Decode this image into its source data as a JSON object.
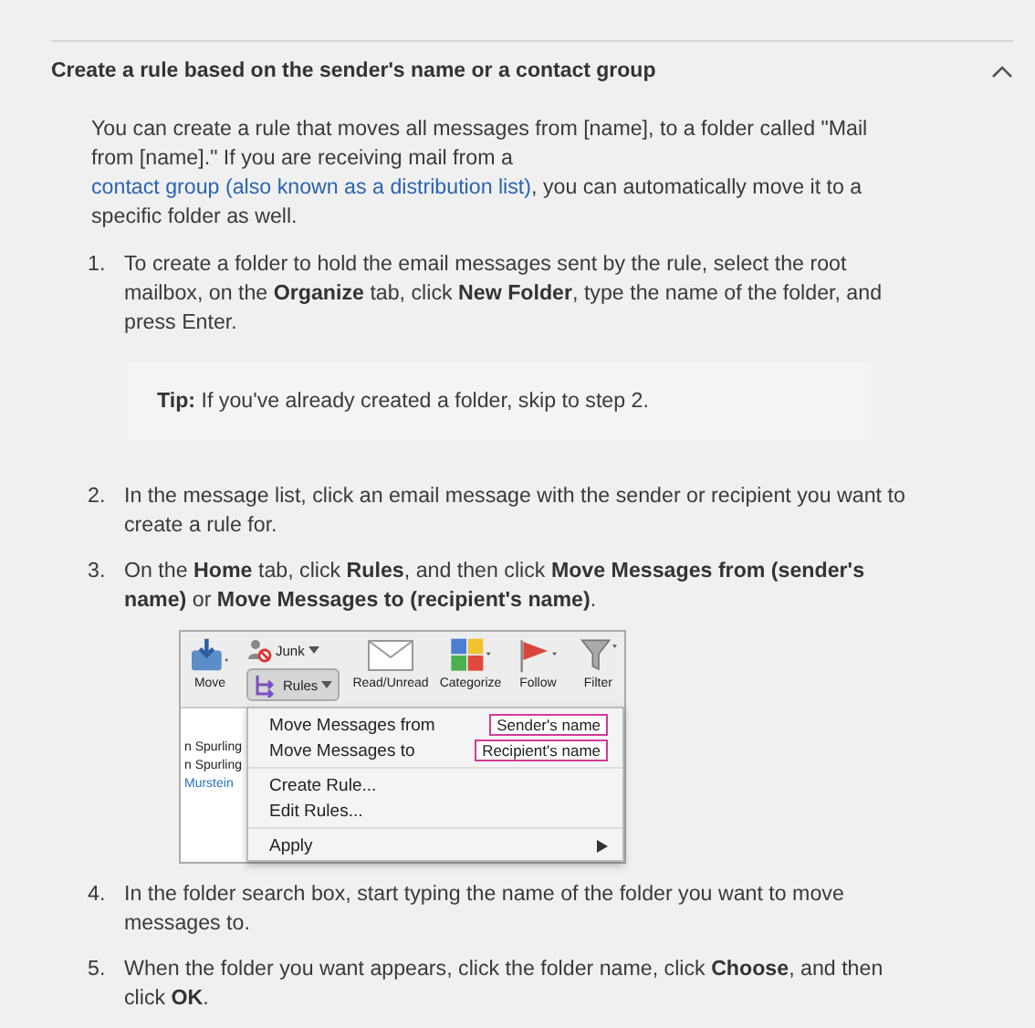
{
  "section": {
    "title": "Create a rule based on the sender's name or a contact group",
    "expanded": true
  },
  "intro": {
    "before": "You can create a rule that moves all messages from [name], to a folder called \"Mail from [name].\" If you are receiving mail from a ",
    "link": "contact group (also known as a distribution list)",
    "after": ", you can automatically move it to a specific folder as well."
  },
  "steps": [
    {
      "number": "1.",
      "text": "To create a folder to hold the email messages sent by the rule, select the root mailbox, on the **Organize** tab, click **New Folder**, type the name of the folder, and press Enter.",
      "tip": {
        "label": "Tip:",
        "text": "If you've already created a folder, skip to step 2."
      }
    },
    {
      "number": "2.",
      "text": "In the message list, click an email message with the sender or recipient you want to create a rule for."
    },
    {
      "number": "3.",
      "text": "On the **Home** tab, click **Rules**, and then click **Move Messages from (sender's name)** or **Move Messages to (recipient's name)**.",
      "figure": {
        "ribbon": [
          {
            "kind": "move",
            "label": "Move"
          },
          {
            "kind": "junk-rules",
            "label": "Junk",
            "label2": "Rules"
          },
          {
            "kind": "read",
            "label": "Read/Unread"
          },
          {
            "kind": "categorize",
            "label": "Categorize"
          },
          {
            "kind": "flag",
            "label": "Follow"
          },
          {
            "kind": "filter",
            "label": "Filter"
          }
        ],
        "list": [
          {
            "text": "n Spurling",
            "kind": "name"
          },
          {
            "text": "n Spurling",
            "kind": "name"
          },
          {
            "text": "Murstein",
            "kind": "link"
          }
        ],
        "menu": [
          [
            {
              "label": "Move Messages from",
              "callout": "Sender's name"
            },
            {
              "label": "Move Messages to",
              "callout": "Recipient's name"
            }
          ],
          [
            {
              "label": "Create Rule..."
            },
            {
              "label": "Edit Rules..."
            }
          ],
          [
            {
              "label": "Apply",
              "submenu": true
            }
          ]
        ]
      }
    },
    {
      "number": "4.",
      "text": "In the folder search box, start typing the name of the folder you want to move messages to."
    },
    {
      "number": "5.",
      "text": "When the folder you want appears, click the folder name, click **Choose**, and then click **OK**."
    }
  ]
}
